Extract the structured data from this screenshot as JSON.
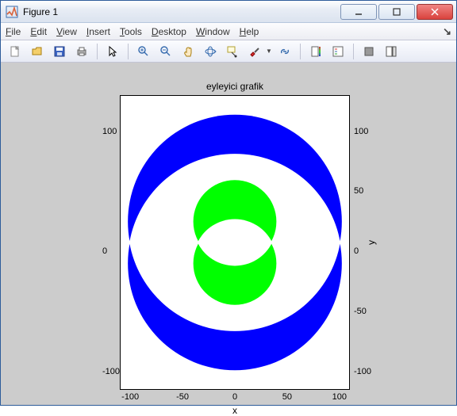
{
  "window": {
    "title": "Figure 1",
    "buttons": {
      "minimize": "minimize",
      "maximize": "maximize",
      "close": "close"
    }
  },
  "menubar": {
    "file": "File",
    "edit": "Edit",
    "view": "View",
    "insert": "Insert",
    "tools": "Tools",
    "desktop": "Desktop",
    "window": "Window",
    "help": "Help",
    "dock": "↘"
  },
  "toolbar": {
    "new": "new-file-icon",
    "open": "open-file-icon",
    "save": "save-icon",
    "print": "print-icon",
    "pointer": "pointer-icon",
    "zoomin": "zoom-in-icon",
    "zoomout": "zoom-out-icon",
    "pan": "pan-icon",
    "rotate": "rotate3d-icon",
    "datacursor": "data-cursor-icon",
    "brush": "brush-icon",
    "link": "link-icon",
    "colorbar": "colorbar-icon",
    "legend": "legend-icon",
    "hide": "hide-plot-tools-icon",
    "show": "show-plot-tools-icon"
  },
  "chart_data": {
    "type": "area",
    "title": "eyleyici grafik",
    "xlabel": "x",
    "ylabel": "y",
    "xlim": [
      -110,
      110
    ],
    "ylim": [
      -115,
      130
    ],
    "xticks": [
      -100,
      -50,
      0,
      50,
      100
    ],
    "yticks_right": [
      -100,
      -50,
      0,
      50,
      100
    ],
    "yticks_left": [
      -100,
      0,
      100
    ],
    "grid": true,
    "series": [
      {
        "name": "outer-upper",
        "shape": "circle",
        "cx": 0,
        "cy": 25,
        "r": 103,
        "fill": "#0000ff"
      },
      {
        "name": "outer-lower",
        "shape": "circle",
        "cx": 0,
        "cy": -10,
        "r": 103,
        "fill": "#0000ff"
      },
      {
        "name": "outer-hole",
        "shape": "lens",
        "cy1": 25,
        "cy2": -10,
        "r": 103,
        "fill": "#ffffff"
      },
      {
        "name": "inner-upper",
        "shape": "circle",
        "cx": 0,
        "cy": 25,
        "r": 40,
        "fill": "#00ff00"
      },
      {
        "name": "inner-lower",
        "shape": "circle",
        "cx": 0,
        "cy": -10,
        "r": 40,
        "fill": "#00ff00"
      },
      {
        "name": "inner-hole",
        "shape": "lens",
        "cy1": 25,
        "cy2": -10,
        "r": 40,
        "fill": "#ffffff"
      }
    ]
  }
}
